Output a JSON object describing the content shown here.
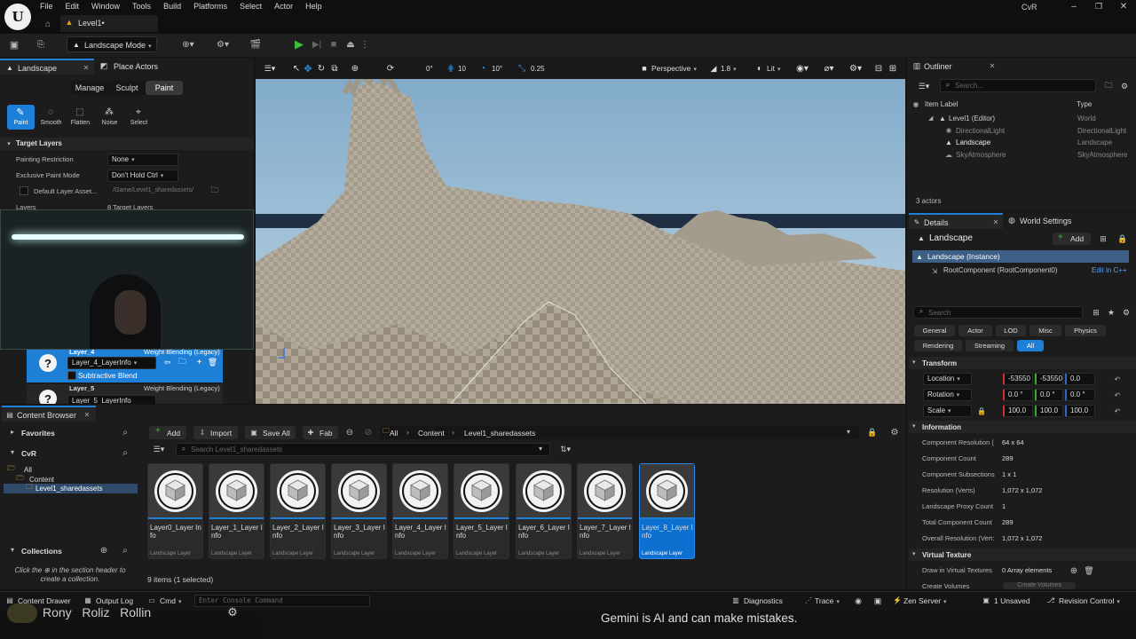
{
  "menu": {
    "items": [
      "File",
      "Edit",
      "Window",
      "Tools",
      "Build",
      "Platforms",
      "Select",
      "Actor",
      "Help"
    ],
    "project": "CvR"
  },
  "level_tab": {
    "label": "Level1•"
  },
  "toolbar": {
    "mode": "Landscape Mode"
  },
  "landscape_panel": {
    "tab_label": "Landscape",
    "place_actors_label": "Place Actors",
    "modes": [
      "Manage",
      "Sculpt",
      "Paint"
    ],
    "active_mode": "Paint",
    "tools": [
      "Paint",
      "Smooth",
      "Flatten",
      "Noise",
      "Select"
    ],
    "target_layers_header": "Target Layers",
    "painting_restriction_label": "Painting Restriction",
    "painting_restriction_value": "None",
    "exclusive_paint_label": "Exclusive Paint Mode",
    "exclusive_paint_value": "Don't Hold Ctrl",
    "default_layer_asset_label": "Default Layer Asset...",
    "default_layer_asset_path": "/Game/Level1_sharedassets/",
    "layers_label": "Layers",
    "layers_count": "8 Target Layers",
    "layer4": {
      "name": "Layer_4",
      "blend": "Weight Blending (Legacy)",
      "info": "Layer_4_LayerInfo",
      "subtractive": "Subtractive Blend"
    },
    "layer5": {
      "name": "Layer_5",
      "blend": "Weight Blending (Legacy)",
      "info": "Layer_5_LayerInfo"
    }
  },
  "viewport": {
    "angle": "0°",
    "grid": "10",
    "rot": "10°",
    "scale": "0.25",
    "perspective": "Perspective",
    "speed": "1.8",
    "lit": "Lit"
  },
  "outliner": {
    "title": "Outliner",
    "search_placeholder": "Search...",
    "col_label": "Item Label",
    "col_type": "Type",
    "rows": [
      {
        "label": "Level1 (Editor)",
        "type": "World"
      },
      {
        "label": "DirectionalLight",
        "type": "DirectionalLight"
      },
      {
        "label": "Landscape",
        "type": "Landscape"
      },
      {
        "label": "SkyAtmosphere",
        "type": "SkyAtmosphere"
      }
    ],
    "actor_count": "3 actors"
  },
  "details": {
    "title": "Details",
    "world_settings": "World Settings",
    "object_name": "Landscape",
    "add_label": "Add",
    "instance_label": "Landscape (Instance)",
    "root_component": "RootComponent (RootComponent0)",
    "edit_in_cpp": "Edit in C++",
    "search_placeholder": "Search",
    "filters": [
      "General",
      "Actor",
      "LOD",
      "Misc",
      "Physics",
      "Rendering",
      "Streaming",
      "All"
    ],
    "transform_header": "Transform",
    "location_label": "Location",
    "location": [
      "-53550",
      "-53550",
      "0.0"
    ],
    "rotation_label": "Rotation",
    "rotation": [
      "0.0 °",
      "0.0 °",
      "0.0 °"
    ],
    "scale_label": "Scale",
    "scale": [
      "100.0",
      "100.0",
      "100.0"
    ],
    "information_header": "Information",
    "info_rows": [
      {
        "k": "Component Resolution (",
        "v": "64 x 64"
      },
      {
        "k": "Component Count",
        "v": "289"
      },
      {
        "k": "Component Subsections",
        "v": "1 x 1"
      },
      {
        "k": "Resolution (Verts)",
        "v": "1,072 x 1,072"
      },
      {
        "k": "Landscape Proxy Count",
        "v": "1"
      },
      {
        "k": "Total Component Count",
        "v": "289"
      },
      {
        "k": "Overall Resolution (Vert:",
        "v": "1,072 x 1,072"
      }
    ],
    "virtual_texture_header": "Virtual Texture",
    "draw_in_vt_label": "Draw in Virtual Textures",
    "draw_in_vt_value": "0 Array elements",
    "create_volumes_label": "Create Volumes",
    "create_volumes_button": "Create Volumes"
  },
  "content_browser": {
    "title": "Content Browser",
    "favorites": "Favorites",
    "project": "CvR",
    "tree": [
      "All",
      "Content",
      "Level1_sharedassets"
    ],
    "collections": "Collections",
    "collections_hint_a": "Click the",
    "collections_hint_b": "in the section header to",
    "collections_hint_c": "create a collection.",
    "add_label": "Add",
    "import_label": "Import",
    "save_all_label": "Save All",
    "fab_label": "Fab",
    "breadcrumb": [
      "All",
      "Content",
      "Level1_sharedassets"
    ],
    "search_placeholder": "Search Level1_sharedassets",
    "assets": [
      {
        "name": "Layer0_Layer Info",
        "type": "Landscape Layer"
      },
      {
        "name": "Layer_1_Layer Info",
        "type": "Landscape Layer"
      },
      {
        "name": "Layer_2_Layer Info",
        "type": "Landscape Layer"
      },
      {
        "name": "Layer_3_Layer Info",
        "type": "Landscape Layer"
      },
      {
        "name": "Layer_4_Layer Info",
        "type": "Landscape Layer"
      },
      {
        "name": "Layer_5_Layer Info",
        "type": "Landscape Layer"
      },
      {
        "name": "Layer_6_Layer Info",
        "type": "Landscape Layer"
      },
      {
        "name": "Layer_7_Layer Info",
        "type": "Landscape Layer"
      },
      {
        "name": "Layer_8_Layer Info",
        "type": "Landscape Layer"
      }
    ],
    "selected_asset_index": 8,
    "item_count": "9 items (1 selected)"
  },
  "status_bar": {
    "content_drawer": "Content Drawer",
    "output_log": "Output Log",
    "cmd": "Cmd",
    "console_placeholder": "Enter Console Command",
    "diagnostics": "Diagnostics",
    "trace": "Trace",
    "zen_server": "Zen Server",
    "unsaved": "1 Unsaved",
    "revision_control": "Revision Control"
  },
  "overlay": {
    "names": "Rony   Roliz   Rollin",
    "gemini_notice": "Gemini is AI and can make mistakes."
  },
  "colors": {
    "accent": "#1e7fd6",
    "play": "#3bbf3b",
    "bg": "#151515",
    "panel": "#1f1f1f"
  }
}
